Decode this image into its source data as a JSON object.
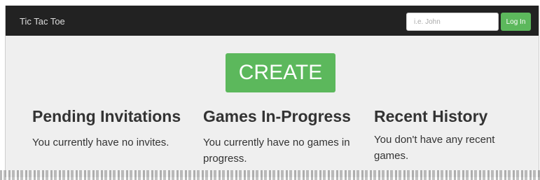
{
  "navbar": {
    "brand": "Tic Tac Toe",
    "login_placeholder": "i.e. John",
    "login_value": "",
    "login_label": "Log In"
  },
  "main": {
    "create_label": "CREATE",
    "sections": [
      {
        "title": "Pending Invitations",
        "message": "You currently have no invites."
      },
      {
        "title": "Games In-Progress",
        "message": "You currently have no games in progress."
      },
      {
        "title": "Recent History",
        "message": "You don't have any recent games."
      }
    ]
  },
  "colors": {
    "navbar_bg": "#222222",
    "page_bg": "#efefef",
    "accent_green": "#5cb85c",
    "text": "#333333"
  }
}
